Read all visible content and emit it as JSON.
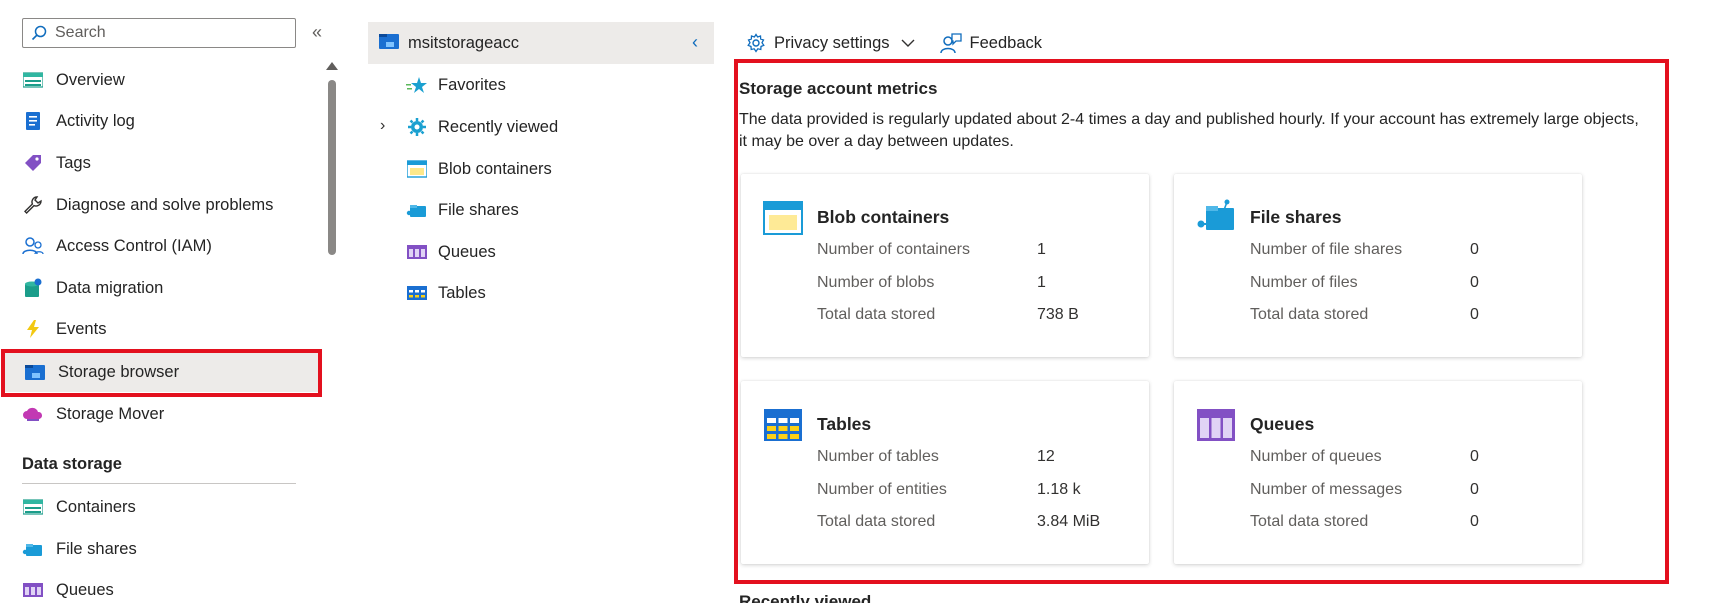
{
  "leftnav": {
    "search_placeholder": "Search",
    "items": [
      {
        "label": "Overview"
      },
      {
        "label": "Activity log"
      },
      {
        "label": "Tags"
      },
      {
        "label": "Diagnose and solve problems"
      },
      {
        "label": "Access Control (IAM)"
      },
      {
        "label": "Data migration"
      },
      {
        "label": "Events"
      },
      {
        "label": "Storage browser"
      },
      {
        "label": "Storage Mover"
      }
    ],
    "section_title": "Data storage",
    "section_items": [
      {
        "label": "Containers"
      },
      {
        "label": "File shares"
      },
      {
        "label": "Queues"
      }
    ]
  },
  "tree": {
    "account": "msitstorageacc",
    "items": [
      {
        "label": "Favorites"
      },
      {
        "label": "Recently viewed"
      },
      {
        "label": "Blob containers"
      },
      {
        "label": "File shares"
      },
      {
        "label": "Queues"
      },
      {
        "label": "Tables"
      }
    ]
  },
  "toolbar": {
    "privacy": "Privacy settings",
    "feedback": "Feedback"
  },
  "metrics": {
    "title": "Storage account metrics",
    "description": "The data provided is regularly updated about 2-4 times a day and published hourly. If your account has extremely large objects, it may be over a day between updates.",
    "cards": [
      {
        "title": "Blob containers",
        "rows": [
          {
            "label": "Number of containers",
            "value": "1"
          },
          {
            "label": "Number of blobs",
            "value": "1"
          },
          {
            "label": "Total data stored",
            "value": "738 B"
          }
        ]
      },
      {
        "title": "File shares",
        "rows": [
          {
            "label": "Number of file shares",
            "value": "0"
          },
          {
            "label": "Number of files",
            "value": "0"
          },
          {
            "label": "Total data stored",
            "value": "0"
          }
        ]
      },
      {
        "title": "Tables",
        "rows": [
          {
            "label": "Number of tables",
            "value": "12"
          },
          {
            "label": "Number of entities",
            "value": "1.18 k"
          },
          {
            "label": "Total data stored",
            "value": "3.84 MiB"
          }
        ]
      },
      {
        "title": "Queues",
        "rows": [
          {
            "label": "Number of queues",
            "value": "0"
          },
          {
            "label": "Number of messages",
            "value": "0"
          },
          {
            "label": "Total data stored",
            "value": "0"
          }
        ]
      }
    ]
  },
  "colors": {
    "accent": "#0f6cbd",
    "highlight": "#e3101e",
    "selected_bg": "#edebe9"
  },
  "below_text": "Recently viewed"
}
